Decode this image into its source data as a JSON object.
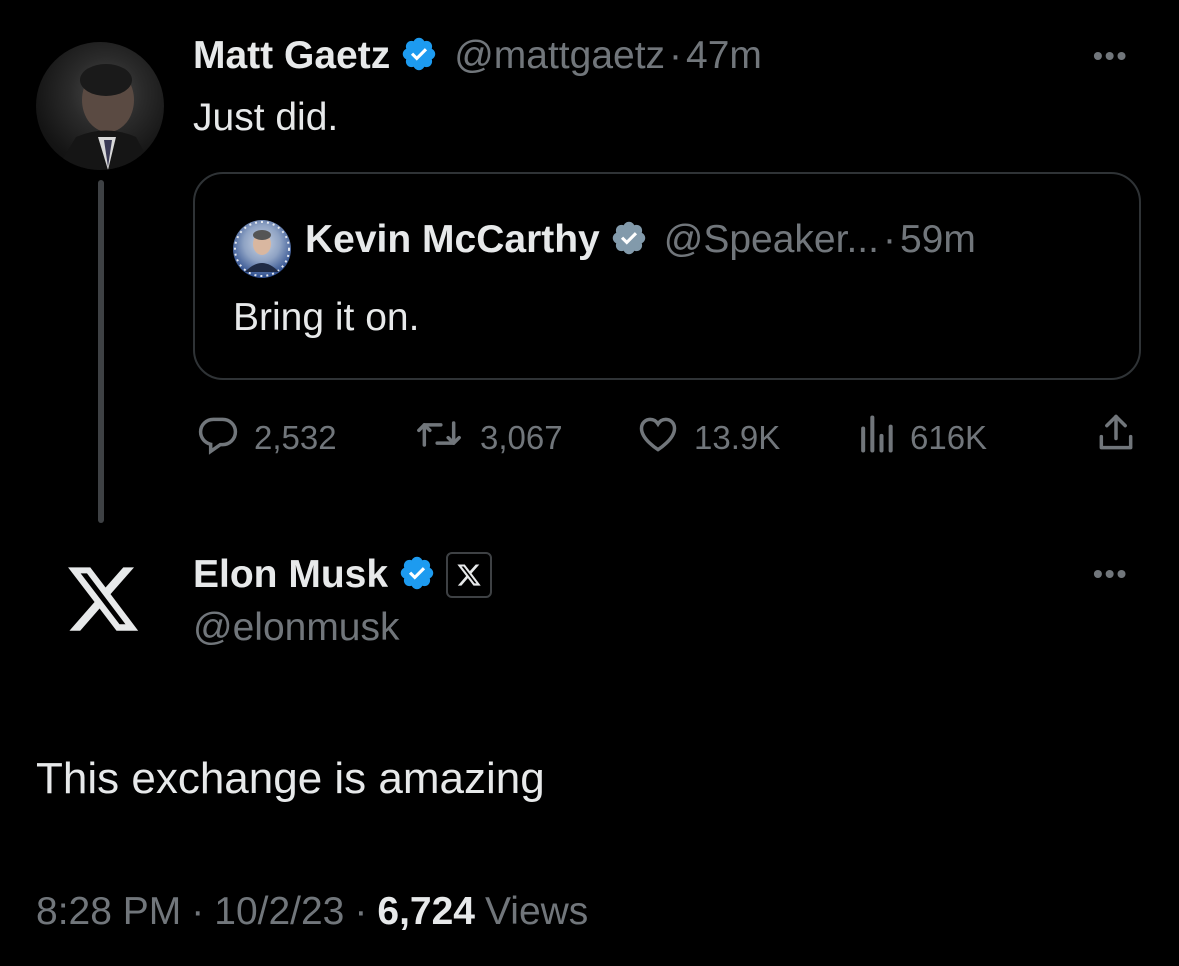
{
  "tweet": {
    "author_name": "Matt Gaetz",
    "handle": "@mattgaetz",
    "separator": "·",
    "time": "47m",
    "text": "Just did.",
    "more": "•••",
    "quote": {
      "author_name": "Kevin McCarthy",
      "handle": "@Speaker...",
      "separator": "·",
      "time": "59m",
      "text": "Bring it on."
    },
    "metrics": {
      "replies": "2,532",
      "retweets": "3,067",
      "likes": "13.9K",
      "views": "616K"
    }
  },
  "reply": {
    "author_name": "Elon Musk",
    "handle": "@elonmusk",
    "more": "•••",
    "text": "This exchange is amazing",
    "timestamp": "8:28 PM",
    "separator1": "·",
    "date": "10/2/23",
    "separator2": "·",
    "view_count": "6,724",
    "views_label": "Views"
  },
  "colors": {
    "verified_blue": "#1d9bf0",
    "verified_gray": "#829aab",
    "muted": "#71767b",
    "text": "#e7e9ea"
  },
  "icons": {
    "reply": "speech-bubble-icon",
    "retweet": "retweet-icon",
    "like": "heart-icon",
    "views": "bar-chart-icon",
    "share": "share-icon"
  }
}
